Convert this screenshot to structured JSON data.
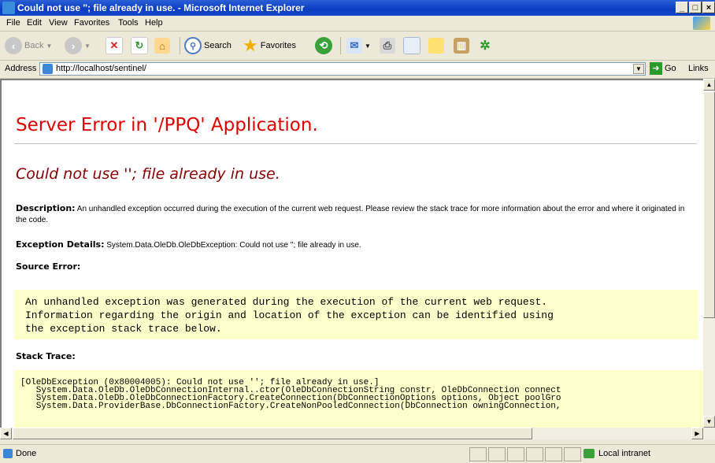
{
  "window": {
    "title": "Could not use ''; file already in use. - Microsoft Internet Explorer"
  },
  "menu": [
    "File",
    "Edit",
    "View",
    "Favorites",
    "Tools",
    "Help"
  ],
  "toolbar": {
    "back": "Back",
    "search": "Search",
    "favorites": "Favorites"
  },
  "address": {
    "label": "Address",
    "url": "http://localhost/sentinel/",
    "go": "Go",
    "links": "Links"
  },
  "page": {
    "heading": "Server Error in '/PPQ' Application.",
    "error_title": "Could not use ''; file already in use.",
    "description_label": "Description:",
    "description_text": "An unhandled exception occurred during the execution of the current web request. Please review the stack trace for more information about the error and where it originated in the code.",
    "exception_label": "Exception Details:",
    "exception_text": "System.Data.OleDb.OleDbException: Could not use ''; file already in use.",
    "source_error_label": "Source Error:",
    "source_error_text": "An unhandled exception was generated during the execution of the current web request.\nInformation regarding the origin and location of the exception can be identified using\nthe exception stack trace below.",
    "stack_trace_label": "Stack Trace:",
    "stack_trace_text": "[OleDbException (0x80004005): Could not use ''; file already in use.]\n   System.Data.OleDb.OleDbConnectionInternal..ctor(OleDbConnectionString constr, OleDbConnection connect\n   System.Data.OleDb.OleDbConnectionFactory.CreateConnection(DbConnectionOptions options, Object poolGro\n   System.Data.ProviderBase.DbConnectionFactory.CreateNonPooledConnection(DbConnection owningConnection,"
  },
  "status": {
    "text": "Done",
    "zone": "Local intranet"
  }
}
